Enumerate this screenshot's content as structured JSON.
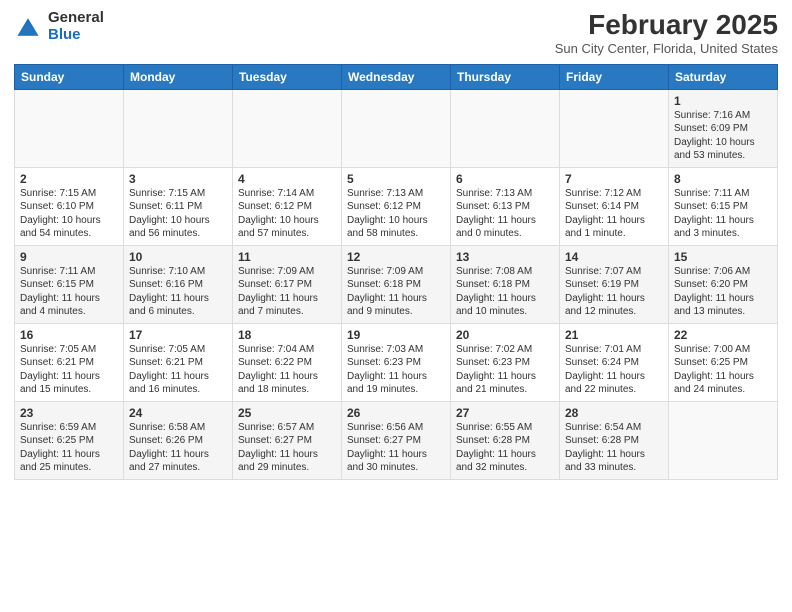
{
  "header": {
    "logo_general": "General",
    "logo_blue": "Blue",
    "main_title": "February 2025",
    "subtitle": "Sun City Center, Florida, United States"
  },
  "days_of_week": [
    "Sunday",
    "Monday",
    "Tuesday",
    "Wednesday",
    "Thursday",
    "Friday",
    "Saturday"
  ],
  "weeks": [
    [
      {
        "day": "",
        "info": ""
      },
      {
        "day": "",
        "info": ""
      },
      {
        "day": "",
        "info": ""
      },
      {
        "day": "",
        "info": ""
      },
      {
        "day": "",
        "info": ""
      },
      {
        "day": "",
        "info": ""
      },
      {
        "day": "1",
        "info": "Sunrise: 7:16 AM\nSunset: 6:09 PM\nDaylight: 10 hours and 53 minutes."
      }
    ],
    [
      {
        "day": "2",
        "info": "Sunrise: 7:15 AM\nSunset: 6:10 PM\nDaylight: 10 hours and 54 minutes."
      },
      {
        "day": "3",
        "info": "Sunrise: 7:15 AM\nSunset: 6:11 PM\nDaylight: 10 hours and 56 minutes."
      },
      {
        "day": "4",
        "info": "Sunrise: 7:14 AM\nSunset: 6:12 PM\nDaylight: 10 hours and 57 minutes."
      },
      {
        "day": "5",
        "info": "Sunrise: 7:13 AM\nSunset: 6:12 PM\nDaylight: 10 hours and 58 minutes."
      },
      {
        "day": "6",
        "info": "Sunrise: 7:13 AM\nSunset: 6:13 PM\nDaylight: 11 hours and 0 minutes."
      },
      {
        "day": "7",
        "info": "Sunrise: 7:12 AM\nSunset: 6:14 PM\nDaylight: 11 hours and 1 minute."
      },
      {
        "day": "8",
        "info": "Sunrise: 7:11 AM\nSunset: 6:15 PM\nDaylight: 11 hours and 3 minutes."
      }
    ],
    [
      {
        "day": "9",
        "info": "Sunrise: 7:11 AM\nSunset: 6:15 PM\nDaylight: 11 hours and 4 minutes."
      },
      {
        "day": "10",
        "info": "Sunrise: 7:10 AM\nSunset: 6:16 PM\nDaylight: 11 hours and 6 minutes."
      },
      {
        "day": "11",
        "info": "Sunrise: 7:09 AM\nSunset: 6:17 PM\nDaylight: 11 hours and 7 minutes."
      },
      {
        "day": "12",
        "info": "Sunrise: 7:09 AM\nSunset: 6:18 PM\nDaylight: 11 hours and 9 minutes."
      },
      {
        "day": "13",
        "info": "Sunrise: 7:08 AM\nSunset: 6:18 PM\nDaylight: 11 hours and 10 minutes."
      },
      {
        "day": "14",
        "info": "Sunrise: 7:07 AM\nSunset: 6:19 PM\nDaylight: 11 hours and 12 minutes."
      },
      {
        "day": "15",
        "info": "Sunrise: 7:06 AM\nSunset: 6:20 PM\nDaylight: 11 hours and 13 minutes."
      }
    ],
    [
      {
        "day": "16",
        "info": "Sunrise: 7:05 AM\nSunset: 6:21 PM\nDaylight: 11 hours and 15 minutes."
      },
      {
        "day": "17",
        "info": "Sunrise: 7:05 AM\nSunset: 6:21 PM\nDaylight: 11 hours and 16 minutes."
      },
      {
        "day": "18",
        "info": "Sunrise: 7:04 AM\nSunset: 6:22 PM\nDaylight: 11 hours and 18 minutes."
      },
      {
        "day": "19",
        "info": "Sunrise: 7:03 AM\nSunset: 6:23 PM\nDaylight: 11 hours and 19 minutes."
      },
      {
        "day": "20",
        "info": "Sunrise: 7:02 AM\nSunset: 6:23 PM\nDaylight: 11 hours and 21 minutes."
      },
      {
        "day": "21",
        "info": "Sunrise: 7:01 AM\nSunset: 6:24 PM\nDaylight: 11 hours and 22 minutes."
      },
      {
        "day": "22",
        "info": "Sunrise: 7:00 AM\nSunset: 6:25 PM\nDaylight: 11 hours and 24 minutes."
      }
    ],
    [
      {
        "day": "23",
        "info": "Sunrise: 6:59 AM\nSunset: 6:25 PM\nDaylight: 11 hours and 25 minutes."
      },
      {
        "day": "24",
        "info": "Sunrise: 6:58 AM\nSunset: 6:26 PM\nDaylight: 11 hours and 27 minutes."
      },
      {
        "day": "25",
        "info": "Sunrise: 6:57 AM\nSunset: 6:27 PM\nDaylight: 11 hours and 29 minutes."
      },
      {
        "day": "26",
        "info": "Sunrise: 6:56 AM\nSunset: 6:27 PM\nDaylight: 11 hours and 30 minutes."
      },
      {
        "day": "27",
        "info": "Sunrise: 6:55 AM\nSunset: 6:28 PM\nDaylight: 11 hours and 32 minutes."
      },
      {
        "day": "28",
        "info": "Sunrise: 6:54 AM\nSunset: 6:28 PM\nDaylight: 11 hours and 33 minutes."
      },
      {
        "day": "",
        "info": ""
      }
    ]
  ]
}
